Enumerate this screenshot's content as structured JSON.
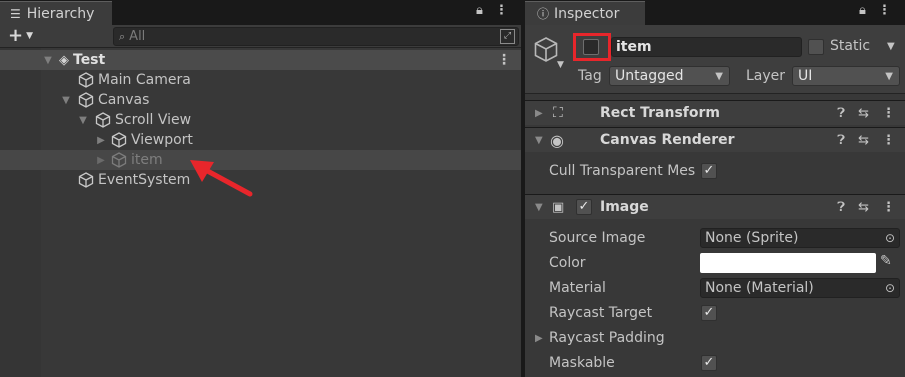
{
  "hierarchy": {
    "tab_title": "Hierarchy",
    "add_label": "+",
    "search_placeholder": "All",
    "scene_name": "Test",
    "items": [
      {
        "label": "Main Camera"
      },
      {
        "label": "Canvas"
      },
      {
        "label": "Scroll View"
      },
      {
        "label": "Viewport"
      },
      {
        "label": "item"
      },
      {
        "label": "EventSystem"
      }
    ]
  },
  "inspector": {
    "tab_title": "Inspector",
    "object_name": "item",
    "active_checked": false,
    "static_label": "Static",
    "tag_label": "Tag",
    "tag_value": "Untagged",
    "layer_label": "Layer",
    "layer_value": "UI",
    "components": {
      "rect_transform": "Rect Transform",
      "canvas_renderer": "Canvas Renderer",
      "image": "Image"
    },
    "cull_label": "Cull Transparent Mes",
    "image_props": {
      "source_image_label": "Source Image",
      "source_image_value": "None (Sprite)",
      "color_label": "Color",
      "color_value": "#ffffff",
      "material_label": "Material",
      "material_value": "None (Material)",
      "raycast_target_label": "Raycast Target",
      "raycast_padding_label": "Raycast Padding",
      "maskable_label": "Maskable"
    }
  },
  "annotation_color": "#e8262b"
}
